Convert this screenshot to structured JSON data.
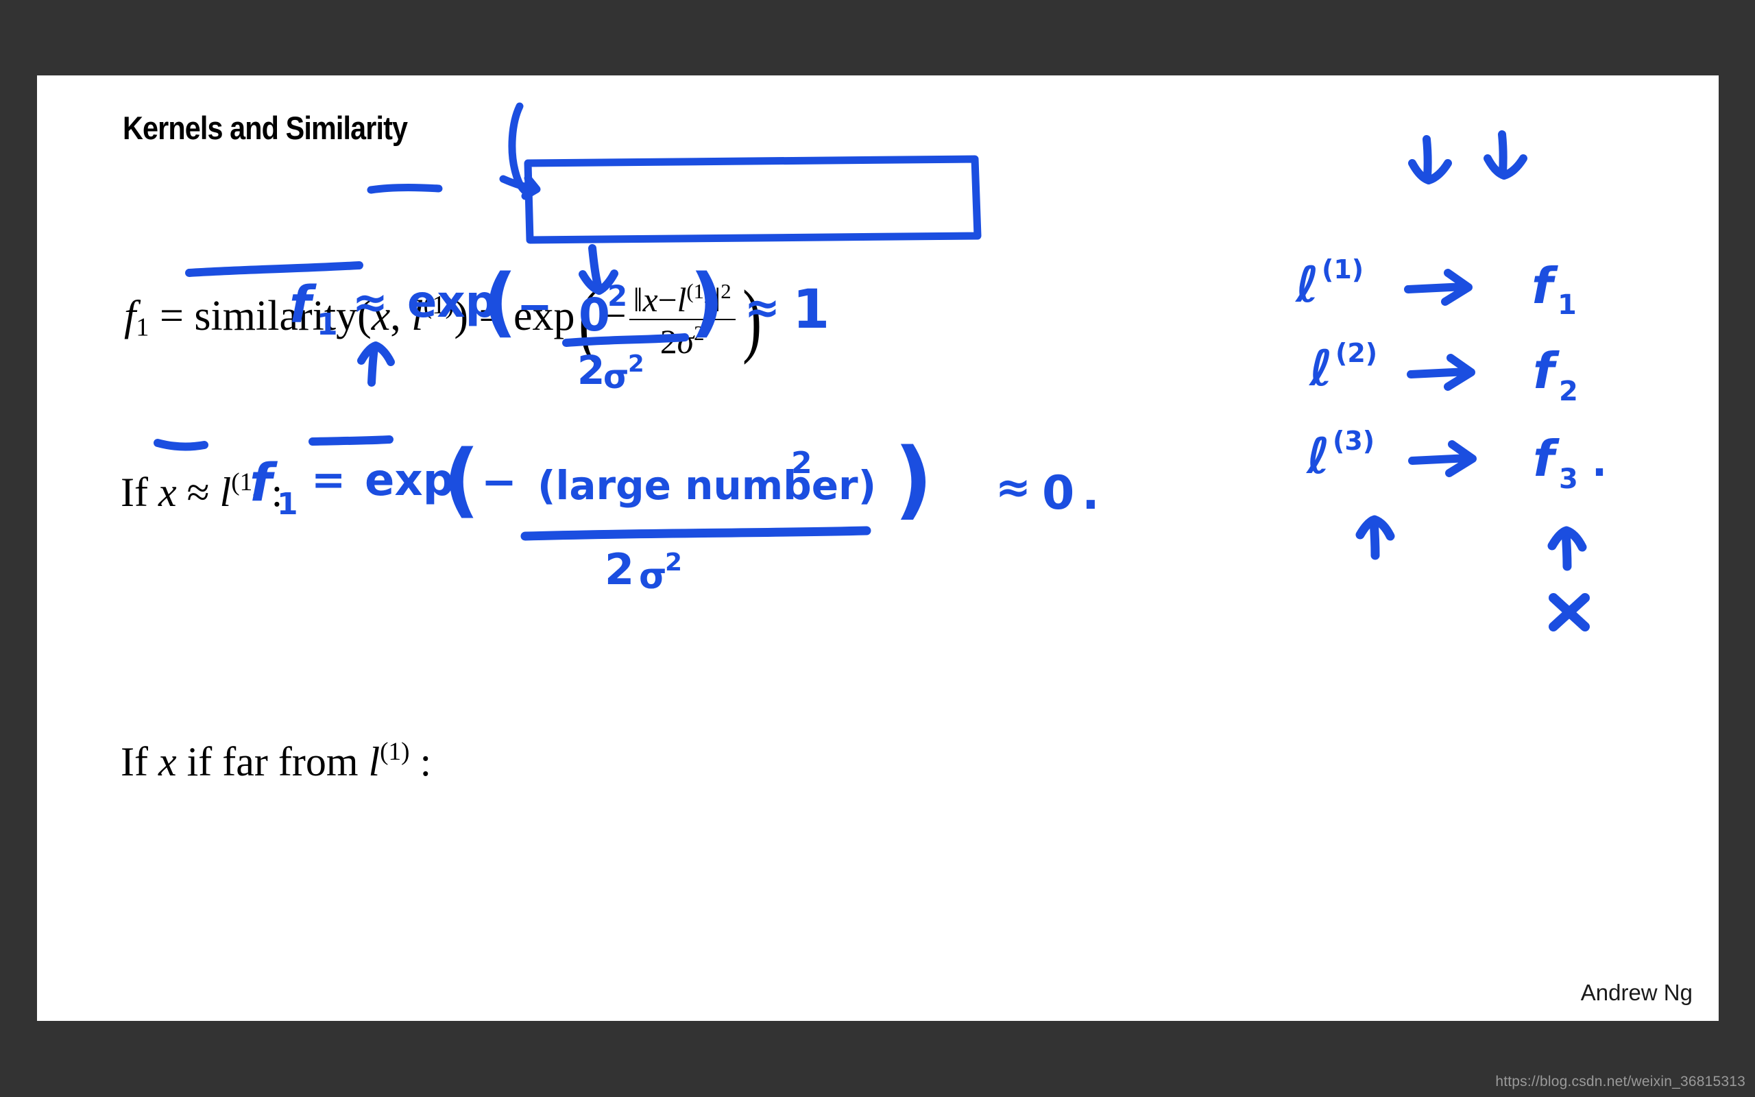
{
  "meta": {
    "background_color": "#333333",
    "slide_color": "#ffffff",
    "ink_color": "#1b4ee0",
    "text_color": "#000000"
  },
  "slide": {
    "title": "Kernels and Similarity",
    "author": "Andrew Ng"
  },
  "watermark": {
    "text": "https://blog.csdn.net/weixin_36815313"
  },
  "printed": {
    "formula_main": {
      "lhs": "f",
      "lhs_sub": "1",
      "eq1": "=",
      "func": "similarity",
      "open": "(",
      "arg1": "x",
      "comma": ",",
      "arg2": "l",
      "arg2_sup": "(1)",
      "close": ")",
      "eq2": "=",
      "exp": "exp",
      "paren_open": "(",
      "minus": "−",
      "num_norm_open": "‖",
      "num_x": "x",
      "num_minus": "−",
      "num_l": "l",
      "num_l_sup": "(1)",
      "num_norm_close": "‖",
      "num_pow": "2",
      "den_2": "2",
      "den_sigma": "σ",
      "den_pow": "2",
      "paren_close": ")"
    },
    "if_line_1": {
      "if": "If",
      "x": "x",
      "approx": "≈",
      "l": "l",
      "l_sup": "(1)",
      "colon": ":"
    },
    "if_line_2": {
      "if": "If",
      "x": "x",
      "words": "if far from",
      "l": "l",
      "l_sup": "(1)",
      "colon": ":"
    }
  },
  "handwriting": {
    "eq_near": {
      "f": "f",
      "f_sub": "1",
      "approx": "≈",
      "exp": "exp",
      "paren_open": "(",
      "minus": "−",
      "num": "0",
      "num_pow": "2",
      "den": "2",
      "den_sigma": "σ",
      "den_pow": "2",
      "paren_close": ")",
      "approx2": "≈",
      "result": "1"
    },
    "eq_far": {
      "f": "f",
      "f_sub": "1",
      "equals": "=",
      "exp": "exp",
      "paren_open": "(",
      "minus": "−",
      "num": "(large number)",
      "num_pow": "2",
      "den": "2",
      "den_sigma": "σ",
      "den_pow": "2",
      "paren_close": ")",
      "approx": "≈",
      "result": "0",
      "period": "."
    },
    "mapping": {
      "rows": [
        {
          "landmark": "ℓ",
          "landmark_sup": "(1)",
          "arrow": "→",
          "feature": "f",
          "feature_sub": "1",
          "trailing": ""
        },
        {
          "landmark": "ℓ",
          "landmark_sup": "(2)",
          "arrow": "→",
          "feature": "f",
          "feature_sub": "2",
          "trailing": ""
        },
        {
          "landmark": "ℓ",
          "landmark_sup": "(3)",
          "arrow": "→",
          "feature": "f",
          "feature_sub": "3",
          "trailing": "."
        }
      ]
    },
    "marks": {
      "x_mark": "×"
    }
  }
}
